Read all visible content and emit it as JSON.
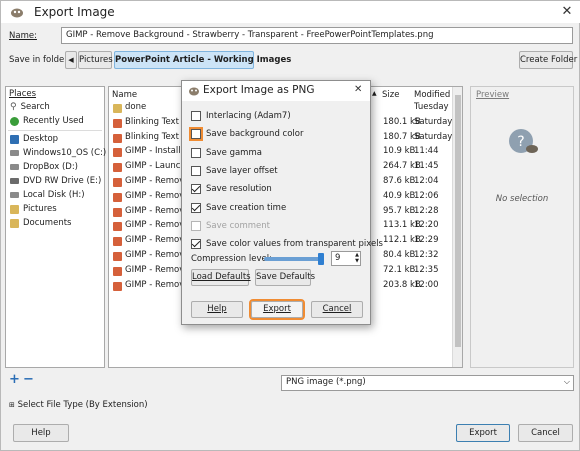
{
  "window": {
    "title": "Export Image",
    "close_glyph": "✕"
  },
  "name_row": {
    "label": "Name:",
    "value": "GIMP - Remove Background - Strawberry - Transparent -  FreePowerPointTemplates.png"
  },
  "folder_row": {
    "label": "Save in folder:",
    "crumbs": [
      "Pictures",
      "PowerPoint Article - Working Images"
    ],
    "create_folder": "Create Folder"
  },
  "places": {
    "header": "Places",
    "items": [
      {
        "label": "Search",
        "icon": "search-icon"
      },
      {
        "label": "Recently Used",
        "icon": "recent-icon"
      },
      {
        "label": "Desktop",
        "icon": "desktop-icon"
      },
      {
        "label": "Windows10_OS (C:)",
        "icon": "drive-icon"
      },
      {
        "label": "DropBox (D:)",
        "icon": "drive-icon"
      },
      {
        "label": "DVD RW Drive (E:)",
        "icon": "dvd-icon"
      },
      {
        "label": "Local Disk (H:)",
        "icon": "drive-icon"
      },
      {
        "label": "Pictures",
        "icon": "folder-icon"
      },
      {
        "label": "Documents",
        "icon": "folder-icon"
      }
    ],
    "add_glyph": "+",
    "remove_glyph": "−"
  },
  "files": {
    "columns": {
      "name": "Name",
      "size": "Size",
      "modified": "Modified"
    },
    "rows": [
      {
        "name": "done",
        "size": "",
        "modified": "Tuesday",
        "folder": true
      },
      {
        "name": "Blinking Text - Ar",
        "size": "180.1 kB",
        "modified": "Saturday"
      },
      {
        "name": "Blinking Text - Fe",
        "size": "180.7 kB",
        "modified": "Saturday"
      },
      {
        "name": "GIMP - Installatio",
        "size": "10.9 kB",
        "modified": "11:44"
      },
      {
        "name": "GIMP - Launch - I",
        "size": "264.7 kB",
        "modified": "11:45"
      },
      {
        "name": "GIMP - Remove B",
        "size": "87.6 kB",
        "modified": "12:04"
      },
      {
        "name": "GIMP - Remove B",
        "size": "40.9 kB",
        "modified": "12:06"
      },
      {
        "name": "GIMP - Remove B",
        "size": "95.7 kB",
        "modified": "12:28"
      },
      {
        "name": "GIMP - Remove B",
        "size": "113.1 kB",
        "modified": "12:20"
      },
      {
        "name": "GIMP - Remove B",
        "size": "112.1 kB",
        "modified": "12:29"
      },
      {
        "name": "GIMP - Remove B",
        "size": "80.4 kB",
        "modified": "12:32"
      },
      {
        "name": "GIMP - Remove B",
        "size": "72.1 kB",
        "modified": "12:35"
      },
      {
        "name": "GIMP - Remove B",
        "size": "203.8 kB",
        "modified": "12:00"
      }
    ]
  },
  "preview": {
    "header": "Preview",
    "empty": "No selection"
  },
  "filetype": {
    "value": "PNG image (*.png)",
    "select_label": "Select File Type (By Extension)"
  },
  "footer": {
    "help": "Help",
    "export": "Export",
    "cancel": "Cancel"
  },
  "dialog": {
    "title": "Export Image as PNG",
    "close_glyph": "✕",
    "options": [
      {
        "label": "Interlacing (Adam7)",
        "checked": false
      },
      {
        "label": "Save background color",
        "checked": false,
        "highlighted": true
      },
      {
        "label": "Save gamma",
        "checked": false
      },
      {
        "label": "Save layer offset",
        "checked": false
      },
      {
        "label": "Save resolution",
        "checked": true
      },
      {
        "label": "Save creation time",
        "checked": true
      },
      {
        "label": "Save comment",
        "checked": false,
        "disabled": true
      },
      {
        "label": "Save color values from transparent pixels",
        "checked": true
      }
    ],
    "compression_label": "Compression level:",
    "compression_value": "9",
    "compression_level": 1.0,
    "load_defaults": "Load Defaults",
    "save_defaults": "Save Defaults",
    "help": "Help",
    "export": "Export",
    "cancel": "Cancel",
    "highlight_color": "#f08c33"
  }
}
